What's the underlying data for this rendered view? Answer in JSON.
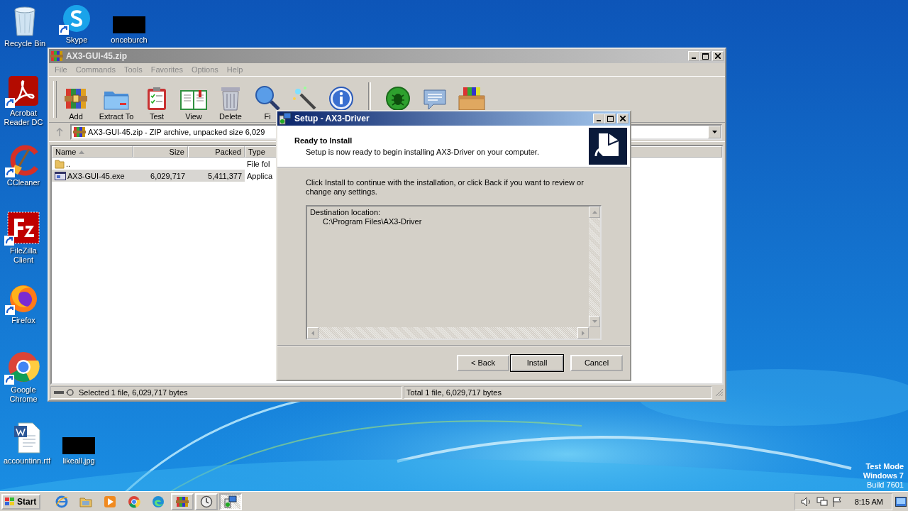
{
  "desktop": {
    "icons": [
      {
        "label": "Recycle Bin",
        "kind": "recycle",
        "shortcut": false
      },
      {
        "label": "Skype",
        "kind": "skype",
        "shortcut": true
      },
      {
        "label": "onceburch",
        "kind": "thumb",
        "shortcut": false
      },
      {
        "label": "Acrobat Reader DC",
        "kind": "acrobat",
        "shortcut": true
      },
      {
        "label": "CCleaner",
        "kind": "ccleaner",
        "shortcut": true
      },
      {
        "label": "FileZilla Client",
        "kind": "filezilla",
        "shortcut": true
      },
      {
        "label": "Firefox",
        "kind": "firefox",
        "shortcut": true
      },
      {
        "label": "Google Chrome",
        "kind": "chrome",
        "shortcut": true
      },
      {
        "label": "accountinn.rtf",
        "kind": "document",
        "shortcut": false
      },
      {
        "label": "likeall.jpg",
        "kind": "thumb",
        "shortcut": false
      }
    ],
    "notice": [
      "Test Mode",
      "Windows 7",
      "Build 7601"
    ]
  },
  "archiver": {
    "title": "AX3-GUI-45.zip",
    "active": false,
    "menu": [
      "File",
      "Commands",
      "Tools",
      "Favorites",
      "Options",
      "Help"
    ],
    "toolbar": [
      {
        "kind": "add",
        "label": "Add"
      },
      {
        "kind": "extract",
        "label": "Extract To"
      },
      {
        "kind": "test",
        "label": "Test"
      },
      {
        "kind": "view",
        "label": "View"
      },
      {
        "kind": "delete",
        "label": "Delete"
      },
      {
        "kind": "find",
        "label": "Fi"
      },
      {
        "kind": "wizard"
      },
      {
        "kind": "info"
      },
      {
        "kind": "separator"
      },
      {
        "kind": "virus"
      },
      {
        "kind": "comment"
      },
      {
        "kind": "sfx"
      }
    ],
    "address": "AX3-GUI-45.zip - ZIP archive, unpacked size 6,029",
    "columns": [
      "Name",
      "Size",
      "Packed",
      "Type"
    ],
    "rows": [
      {
        "kind": "folder",
        "name": "..",
        "type": "File fol",
        "selected": false
      },
      {
        "kind": "exe",
        "name": "AX3-GUI-45.exe",
        "size": "6,029,717",
        "packed": "5,411,377",
        "type": "Applica",
        "selected": true
      }
    ],
    "status": [
      "Selected 1 file, 6,029,717 bytes",
      "Total 1 file, 6,029,717 bytes"
    ]
  },
  "setup": {
    "title": "Setup - AX3-Driver",
    "active": true,
    "heading": "Ready to Install",
    "subheading": "Setup is now ready to begin installing AX3-Driver on your computer.",
    "intro": "Click Install to continue with the installation, or click Back if you want to review or change any settings.",
    "memo": {
      "label": "Destination location:",
      "value": "C:\\Program Files\\AX3-Driver"
    },
    "buttons": [
      {
        "label": "< Back",
        "default": false
      },
      {
        "label": "Install",
        "default": true
      },
      {
        "label": "Cancel",
        "default": false
      }
    ]
  },
  "taskbar": {
    "start": "Start",
    "apps": [
      {
        "kind": "ie",
        "running": false,
        "selected": false
      },
      {
        "kind": "explorer",
        "running": false,
        "selected": false
      },
      {
        "kind": "media",
        "running": false,
        "selected": false
      },
      {
        "kind": "chrome",
        "running": false,
        "selected": false
      },
      {
        "kind": "edge",
        "running": false,
        "selected": false
      },
      {
        "kind": "winrar",
        "running": true,
        "selected": false
      },
      {
        "kind": "clock",
        "running": true,
        "selected": false
      },
      {
        "kind": "setup",
        "running": true,
        "selected": true
      }
    ],
    "clock": "8:15 AM"
  }
}
